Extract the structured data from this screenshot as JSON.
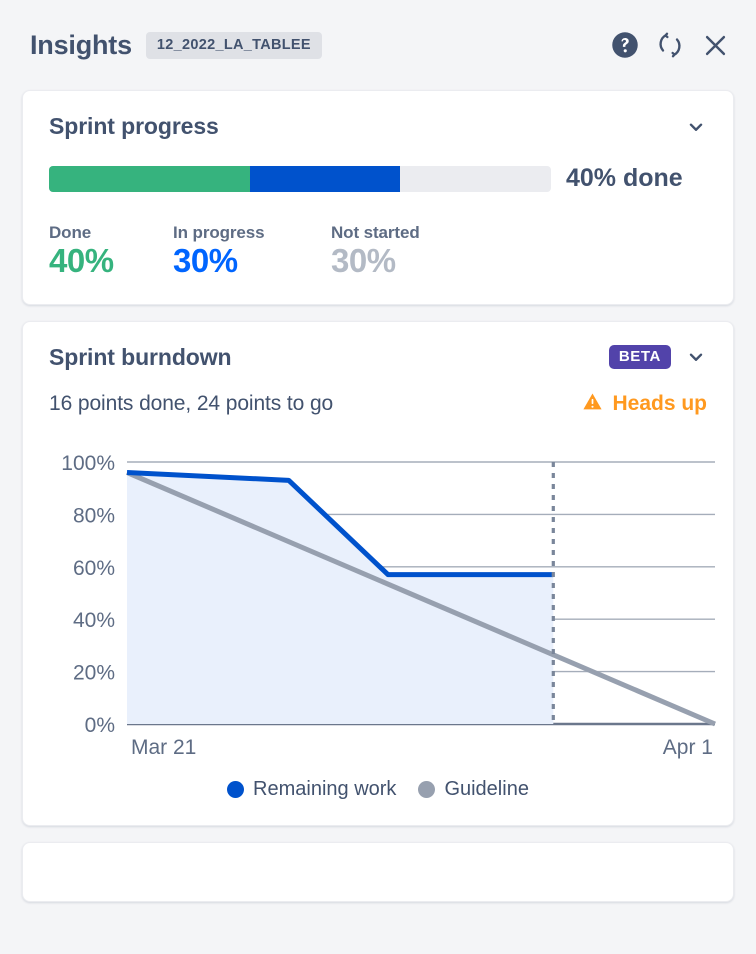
{
  "header": {
    "title": "Insights",
    "board_chip": "12_2022_LA_TABLEE",
    "help_icon": "help-circle-icon",
    "refresh_icon": "refresh-icon",
    "close_icon": "close-icon"
  },
  "sprint_progress": {
    "title": "Sprint progress",
    "collapse_icon": "chevron-down-icon",
    "progress_label": "40% done",
    "bar": {
      "done_pct": 40,
      "in_progress_pct": 30,
      "not_started_pct": 30,
      "done_color": "#36B37E",
      "in_progress_color": "#0052CC",
      "not_started_color": "#EBECF0"
    },
    "stats": [
      {
        "label": "Done",
        "value": "40%",
        "color": "#36B37E"
      },
      {
        "label": "In progress",
        "value": "30%",
        "color": "#0065FF"
      },
      {
        "label": "Not started",
        "value": "30%",
        "color": "#B3BAC5"
      }
    ]
  },
  "sprint_burndown": {
    "title": "Sprint burndown",
    "badge": "BETA",
    "badge_color": "#5243AA",
    "collapse_icon": "chevron-down-icon",
    "summary": "16 points done, 24 points to go",
    "points_done": 16,
    "points_to_go": 24,
    "warning": {
      "icon": "warning-triangle-icon",
      "label": "Heads up",
      "color": "#FF991F"
    }
  },
  "chart_data": {
    "type": "line",
    "title": "Sprint burndown",
    "xlabel": "",
    "ylabel": "",
    "ylim": [
      0,
      100
    ],
    "y_ticks": [
      "0%",
      "20%",
      "40%",
      "60%",
      "80%",
      "100%"
    ],
    "y_tick_values": [
      0,
      20,
      40,
      60,
      80,
      100
    ],
    "x_ticks": [
      "Mar 21",
      "Apr 1"
    ],
    "x_range": [
      "Mar 21",
      "Apr 1"
    ],
    "grid": true,
    "legend_position": "bottom",
    "today_marker": {
      "style": "dotted",
      "x_fraction": 0.725,
      "color": "#7A869A"
    },
    "series": [
      {
        "name": "Remaining work",
        "color": "#0052CC",
        "fill": "#E9F0FC",
        "step": true,
        "points": [
          {
            "x_fraction": 0.0,
            "y": 96
          },
          {
            "x_fraction": 0.275,
            "y": 93
          },
          {
            "x_fraction": 0.444,
            "y": 57
          },
          {
            "x_fraction": 0.725,
            "y": 57
          }
        ]
      },
      {
        "name": "Guideline",
        "color": "#97A0AF",
        "points": [
          {
            "x_fraction": 0.0,
            "y": 96
          },
          {
            "x_fraction": 1.0,
            "y": 0
          }
        ]
      }
    ],
    "legend": [
      {
        "label": "Remaining work",
        "color": "#0052CC"
      },
      {
        "label": "Guideline",
        "color": "#97A0AF"
      }
    ]
  }
}
